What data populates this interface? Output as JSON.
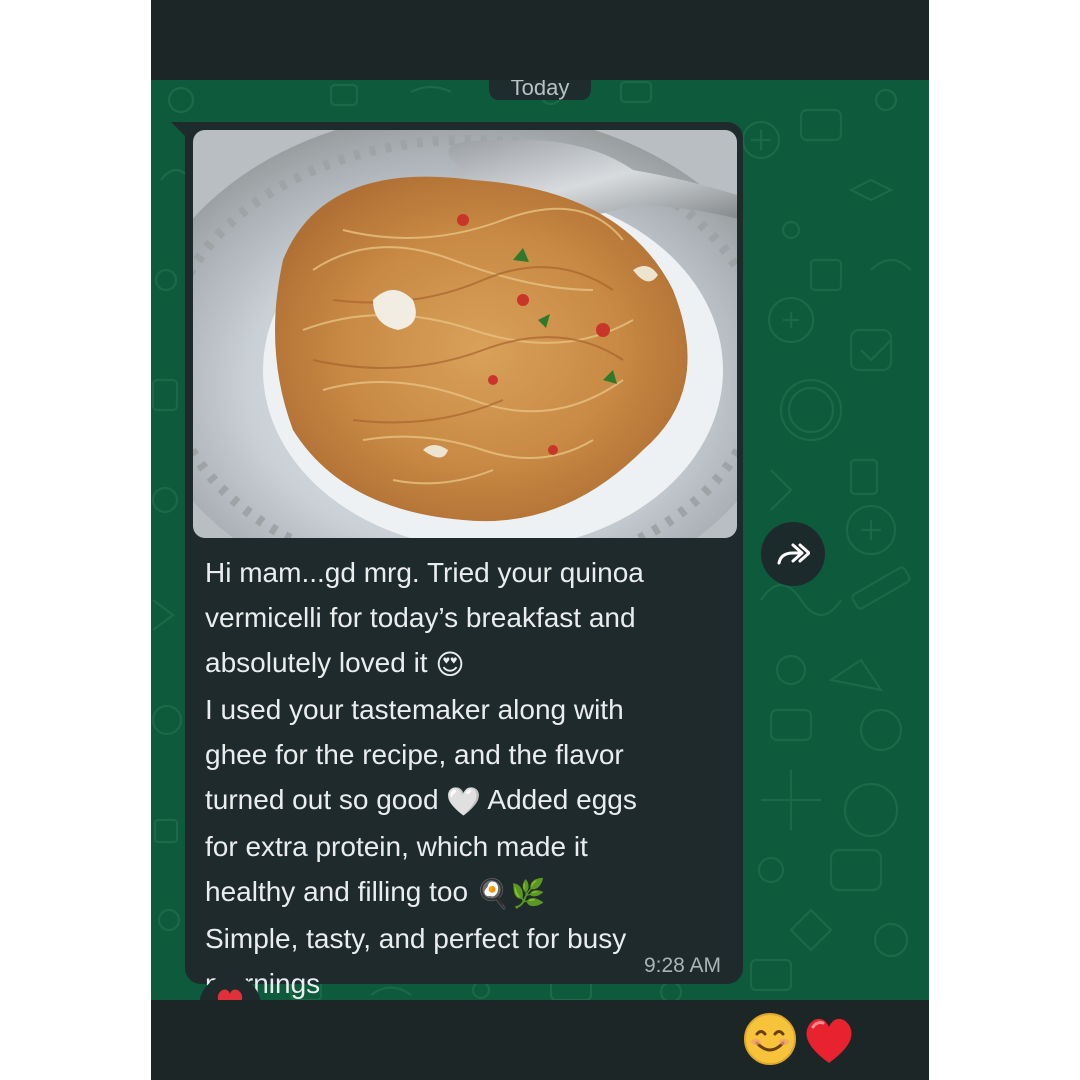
{
  "chat": {
    "date_label": "Today",
    "message": {
      "lines": [
        "Hi mam...gd mrg. Tried your quinoa",
        "vermicelli for today’s breakfast and",
        "absolutely loved it",
        "I used your tastemaker along with",
        "ghee for the recipe, and the flavor",
        "turned out so good",
        "Added eggs",
        "for extra protein, which made it",
        "healthy and filling too",
        "Simple, tasty, and perfect for busy",
        "mornings"
      ],
      "time": "9:28 AM",
      "reaction": "heart"
    },
    "forward_icon": "forward-icon"
  },
  "footer": {
    "emojis": [
      "smiling-face-icon",
      "red-heart-icon"
    ]
  },
  "colors": {
    "chat_background": "#0e5a3c",
    "bubble": "#1f2a2c",
    "text": "#e9edee",
    "timestamp": "#a9b4b5",
    "bars": "#1c2627"
  }
}
